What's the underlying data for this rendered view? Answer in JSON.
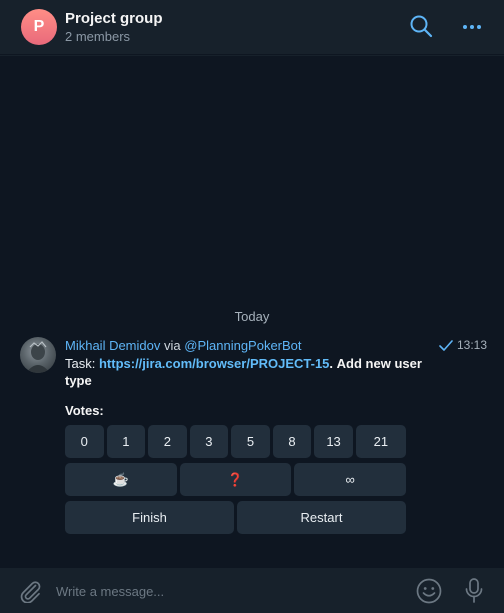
{
  "header": {
    "avatar_letter": "P",
    "title": "Project group",
    "subtitle": "2 members",
    "icons": [
      "search-icon",
      "more-icon"
    ]
  },
  "chat": {
    "date_separator": "Today",
    "message": {
      "sender": "Mikhail Demidov",
      "via": "via",
      "bot": "@PlanningPokerBot",
      "time": "13:13",
      "status_icon": "check-icon",
      "task_label": "Task:",
      "task_link": "https://jira.com/browser/PROJECT-15",
      "task_suffix": ".",
      "task_title": "Add new user type",
      "votes_label": "Votes:",
      "keyboard": {
        "row1": [
          "0",
          "1",
          "2",
          "3",
          "5",
          "8",
          "13",
          "21"
        ],
        "row2": [
          "☕",
          "❓",
          "∞"
        ],
        "row3": [
          "Finish",
          "Restart"
        ]
      }
    }
  },
  "composer": {
    "placeholder": "Write a message...",
    "icons": [
      "paperclip-icon",
      "emoji-icon",
      "microphone-icon"
    ]
  },
  "colors": {
    "background": "#0e1621",
    "panel": "#17212b",
    "accent": "#5eb5f7",
    "button": "#222f3c",
    "avatar_gradient": [
      "#ff8e86",
      "#e96a7b"
    ]
  }
}
